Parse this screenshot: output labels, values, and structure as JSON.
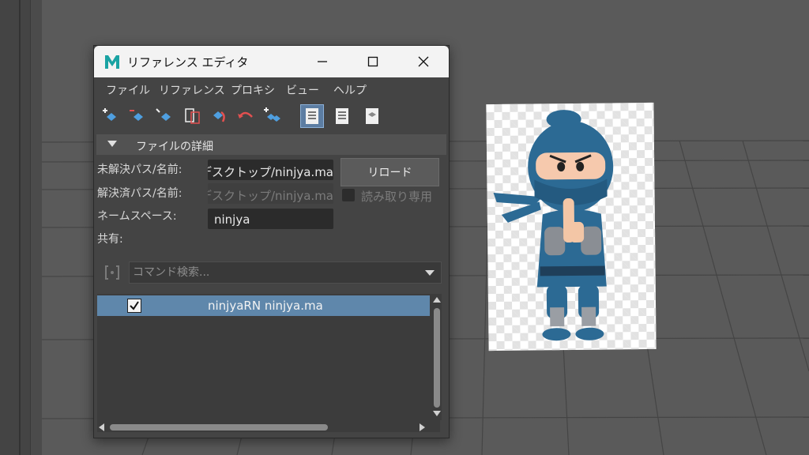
{
  "window": {
    "title": "リファレンス エディタ",
    "app_icon": "maya-m-icon",
    "controls": [
      "minimize-icon",
      "maximize-icon",
      "close-icon"
    ]
  },
  "menu": [
    "ファイル",
    "リファレンス",
    "プロキシ",
    "ビュー",
    "ヘルプ"
  ],
  "toolbar_icons": [
    "create-reference-icon",
    "remove-reference-icon",
    "load-reference-icon",
    "import-objects-icon",
    "reload-reference-icon",
    "undo-icon",
    "duplicate-reference-icon",
    "list-view-icon",
    "detail-view-icon",
    "proxy-view-icon"
  ],
  "details": {
    "title": "ファイルの詳細",
    "unresolved_label": "未解決パス/名前:",
    "unresolved_value": "デスクトップ/ninjya.ma",
    "resolved_label": "解決済パス/名前:",
    "resolved_value": "デスクトップ/ninjya.ma",
    "namespace_label": "ネームスペース:",
    "namespace_value": "ninjya",
    "shared_label": "共有:",
    "reload_button": "リロード",
    "readonly_label": "読み取り専用"
  },
  "command_search": {
    "placeholder": "コマンド検索..."
  },
  "references": [
    {
      "checked": true,
      "name": "ninjyaRN ninjya.ma"
    }
  ],
  "colors": {
    "panel": "#444444",
    "selection": "#5f87ab",
    "field": "#2b2b2b",
    "ninja_blue": "#2c6a94"
  }
}
